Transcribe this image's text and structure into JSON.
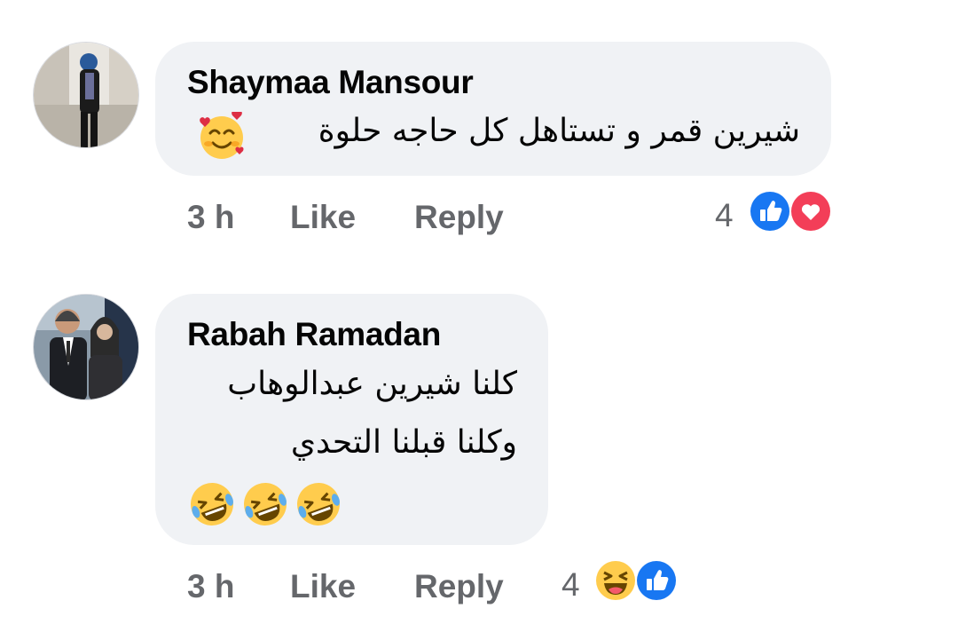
{
  "comments": [
    {
      "author": "Shaymaa Mansour",
      "lines": [
        "شيرين قمر و تستاهل كل حاجه حلوة"
      ],
      "emoji": [
        "smiling-face-with-hearts"
      ],
      "time": "3 h",
      "like_label": "Like",
      "reply_label": "Reply",
      "reaction_count": "4",
      "reactions": [
        "like",
        "love"
      ]
    },
    {
      "author": "Rabah Ramadan",
      "lines": [
        "كلنا شيرين عبدالوهاب",
        "وكلنا قبلنا التحدي"
      ],
      "emoji": [
        "rolling-on-floor-laughing",
        "rolling-on-floor-laughing",
        "rolling-on-floor-laughing"
      ],
      "time": "3 h",
      "like_label": "Like",
      "reply_label": "Reply",
      "reaction_count": "4",
      "reactions": [
        "haha",
        "like"
      ]
    }
  ],
  "colors": {
    "bubble_bg": "#f0f2f5",
    "meta_text": "#65676b",
    "like_blue": "#1877f2",
    "love_red": "#f33e58",
    "emoji_yellow": "#ffcc4d"
  }
}
